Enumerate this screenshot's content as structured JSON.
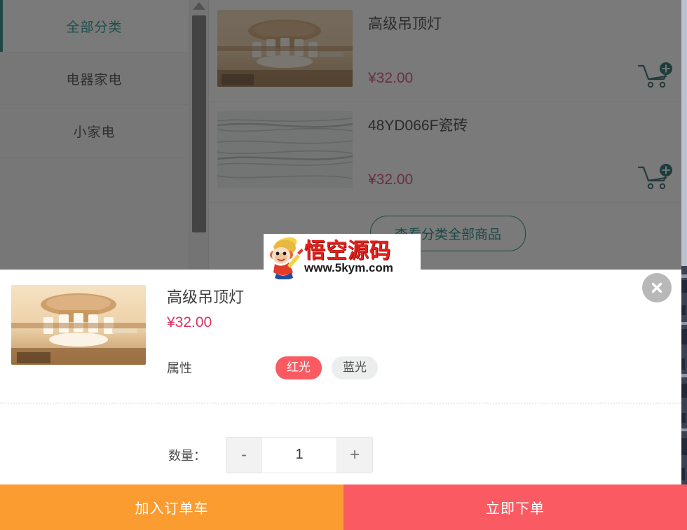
{
  "sidebar": {
    "items": [
      {
        "label": "全部分类",
        "active": true
      },
      {
        "label": "电器家电",
        "active": false
      },
      {
        "label": "小家电",
        "active": false
      }
    ]
  },
  "product_list": {
    "items": [
      {
        "title": "高级吊顶灯",
        "price": "¥32.00",
        "image": "ceiling-lamp",
        "cart_icon": "cart-plus-icon"
      },
      {
        "title": "48YD066F瓷砖",
        "price": "¥32.00",
        "image": "marble-tile",
        "cart_icon": "cart-plus-icon"
      }
    ],
    "view_all_label": "查看分类全部商品"
  },
  "sku_modal": {
    "product_name": "高级吊顶灯",
    "price": "¥32.00",
    "image": "ceiling-lamp",
    "close_icon": "close-circle-icon",
    "attribute": {
      "label": "属性",
      "options": [
        {
          "label": "红光",
          "selected": true
        },
        {
          "label": "蓝光",
          "selected": false
        }
      ]
    },
    "quantity": {
      "label": "数量：",
      "decrement": "-",
      "value": "1",
      "increment": "+"
    }
  },
  "action_bar": {
    "add_to_cart": "加入订单车",
    "buy_now": "立即下单"
  },
  "watermark": {
    "brand_cn": "悟空源码",
    "url": "www.5kym.com"
  },
  "colors": {
    "accent_teal": "#0c7b74",
    "price_red": "#d23b63",
    "tag_selected": "#fa5a62",
    "add_cart_orange": "#fb9c31",
    "buy_now_red": "#fa5a62",
    "overlay": "rgba(40,40,40,0.62)"
  }
}
